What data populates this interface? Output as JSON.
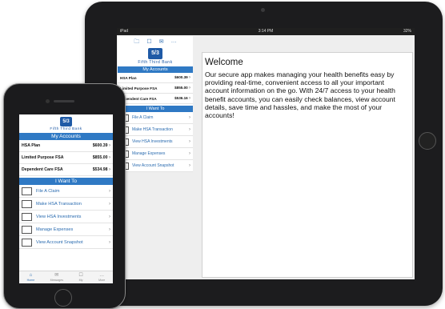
{
  "brand": {
    "logo_mark": "5/3",
    "name": "Fifth Third Bank"
  },
  "tablet": {
    "status": {
      "left": "iPad",
      "center": "3:14 PM",
      "right": "32%"
    },
    "top_icons": [
      "folder-icon",
      "bookmark-icon",
      "mail-icon",
      "more-icon"
    ],
    "accounts_header": "My Accounts",
    "accounts": [
      {
        "name": "HSA Plan",
        "amount": "$600.39"
      },
      {
        "name": "Limited Purpose FSA",
        "amount": "$855.00"
      },
      {
        "name": "Dependent Care FSA",
        "amount": "$536.16"
      }
    ],
    "actions_header": "I Want To",
    "actions": [
      {
        "label": "File A Claim"
      },
      {
        "label": "Make HSA Transaction"
      },
      {
        "label": "View HSA Investments"
      },
      {
        "label": "Manage Expenses"
      },
      {
        "label": "View Account Snapshot"
      }
    ],
    "welcome_title": "Welcome",
    "welcome_body": "Our secure app makes managing your health benefits easy by providing real-time, convenient access to all your important account information on the go. With 24/7 access to your health benefit accounts, you can easily check balances, view account details, save time and hassles, and make the most of your accounts!"
  },
  "phone": {
    "accounts_header": "My Accounts",
    "accounts": [
      {
        "name": "HSA Plan",
        "amount": "$600.39"
      },
      {
        "name": "Limited Purpose FSA",
        "amount": "$855.00"
      },
      {
        "name": "Dependent Care FSA",
        "amount": "$534.98"
      }
    ],
    "actions_header": "I Want To",
    "actions": [
      {
        "label": "File A Claim"
      },
      {
        "label": "Make HSA Transaction"
      },
      {
        "label": "View HSA Investments"
      },
      {
        "label": "Manage Expenses"
      },
      {
        "label": "View Account Snapshot"
      }
    ],
    "tabs": [
      {
        "label": "Home",
        "icon": "home-icon"
      },
      {
        "label": "Messages",
        "icon": "mail-icon"
      },
      {
        "label": "My",
        "icon": "bookmark-icon"
      },
      {
        "label": "More",
        "icon": "more-icon"
      }
    ]
  },
  "chevron": "›",
  "colors": {
    "accent": "#2f79c4",
    "brand": "#1f5aa6",
    "link": "#2b6cb0"
  }
}
